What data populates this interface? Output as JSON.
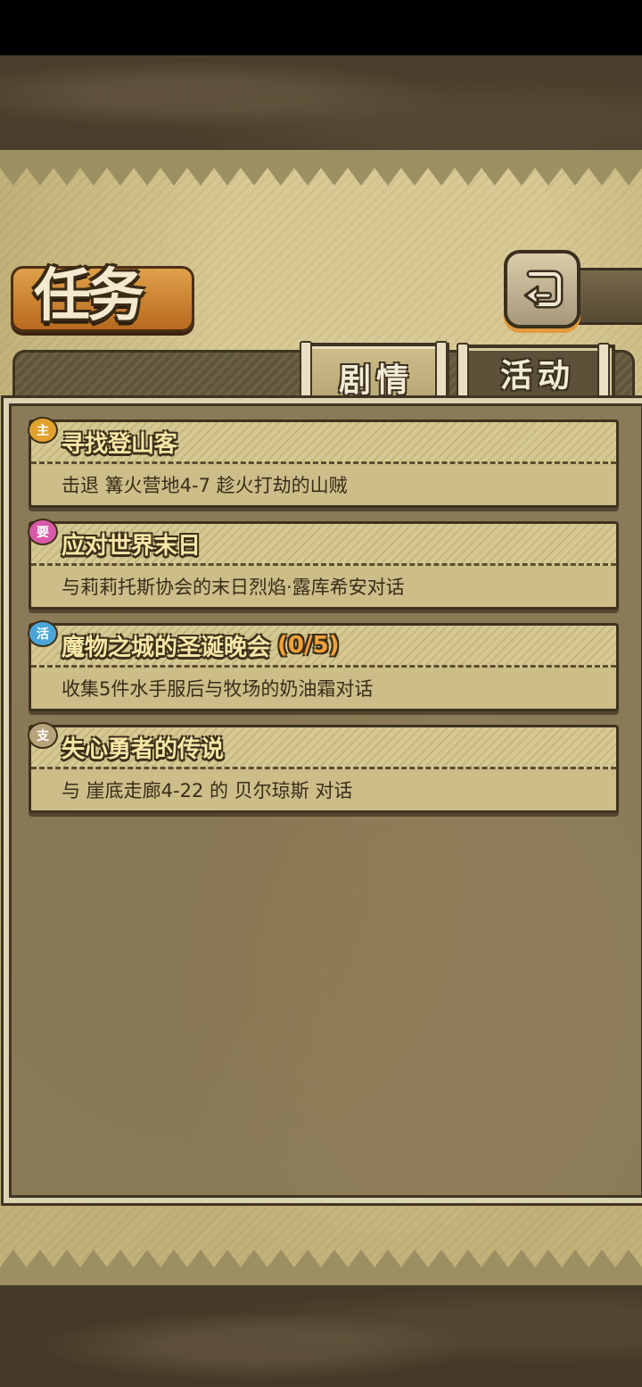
{
  "page": {
    "title": "任务"
  },
  "tabs": [
    {
      "label": "剧情",
      "selected": true
    },
    {
      "label": "活动",
      "selected": false
    }
  ],
  "quests": [
    {
      "badge": "主",
      "badge_color": "#e0a12e",
      "title": "寻找登山客",
      "progress": "",
      "description": "击退 篝火营地4-7 趁火打劫的山贼"
    },
    {
      "badge": "要",
      "badge_color": "#d95aa8",
      "title": "应对世界末日",
      "progress": "",
      "description": "与莉莉托斯协会的末日烈焰·露库希安对话"
    },
    {
      "badge": "活",
      "badge_color": "#4aa6d8",
      "title": "魔物之城的圣诞晚会",
      "progress": "(0/5)",
      "description": "收集5件水手服后与牧场的奶油霜对话"
    },
    {
      "badge": "支",
      "badge_color": "#b7a37a",
      "title": "失心勇者的传说",
      "progress": "",
      "description": "与 崖底走廊4-22 的 贝尔琼斯 对话"
    }
  ],
  "icons": {
    "back": "return-arrow-icon"
  }
}
